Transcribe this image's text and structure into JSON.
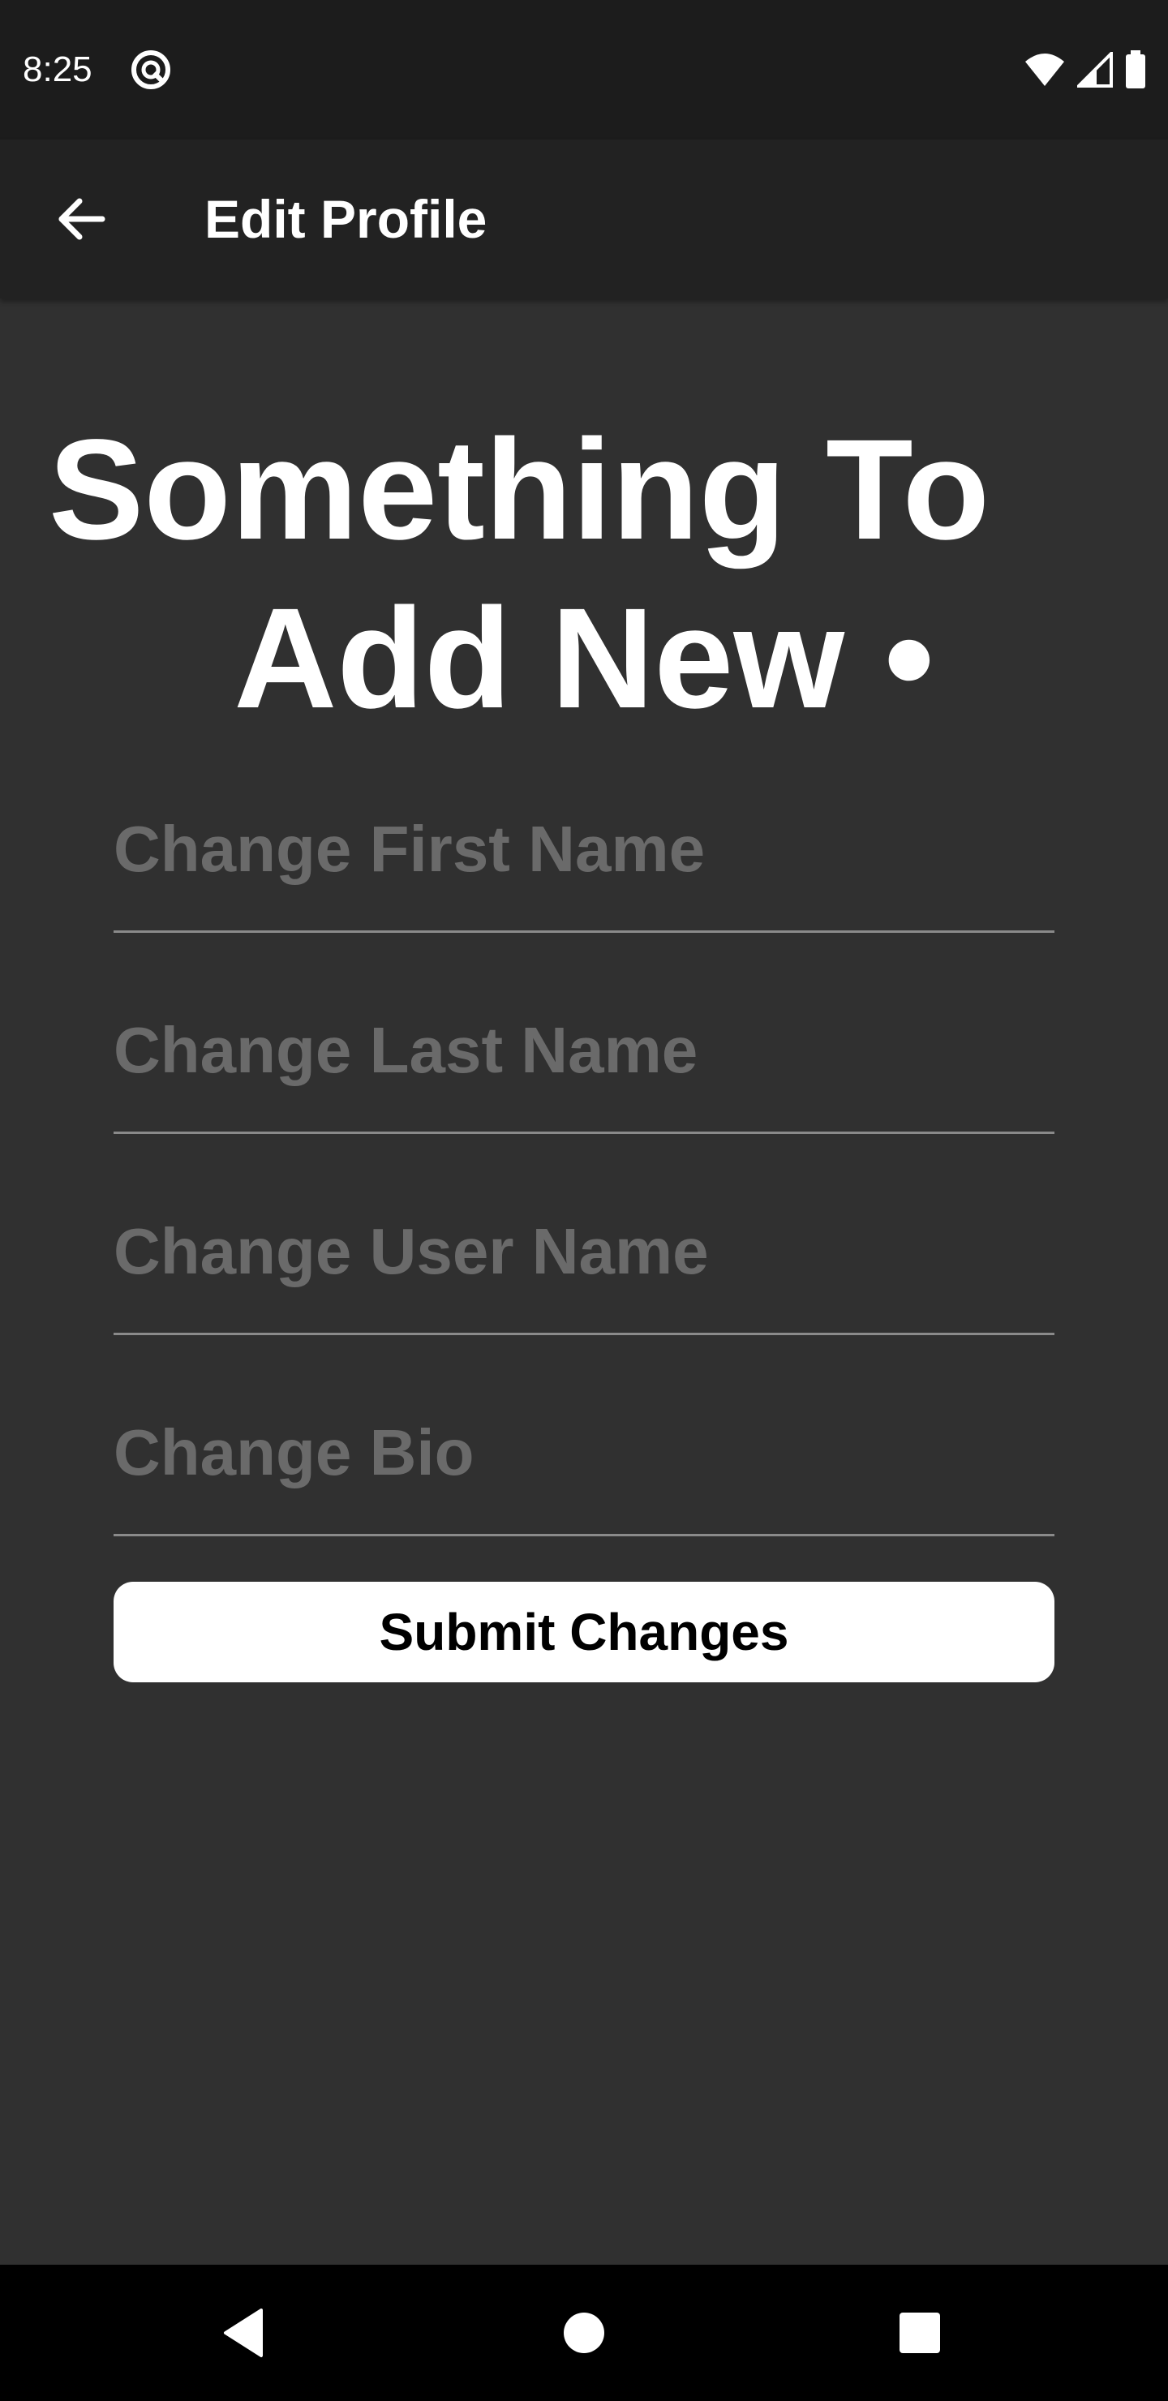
{
  "status_bar": {
    "time": "8:25",
    "app_icon": "at-sign-icon",
    "icons": [
      "wifi-icon",
      "signal-icon",
      "battery-icon"
    ]
  },
  "app_bar": {
    "back_icon": "arrow-left-icon",
    "title": "Edit Profile"
  },
  "headline": {
    "line1": "Something To",
    "line2": "Add New •"
  },
  "form": {
    "first_name": {
      "placeholder": "Change First Name",
      "value": ""
    },
    "last_name": {
      "placeholder": "Change Last Name",
      "value": ""
    },
    "user_name": {
      "placeholder": "Change User Name",
      "value": ""
    },
    "bio": {
      "placeholder": "Change Bio",
      "value": ""
    },
    "submit_label": "Submit Changes"
  },
  "nav_bar": {
    "back": "triangle-back-icon",
    "home": "circle-home-icon",
    "recents": "square-recents-icon"
  },
  "colors": {
    "background": "#303030",
    "status_bar": "#1c1c1c",
    "app_bar": "#222222",
    "placeholder": "#6a6a6a",
    "divider": "#8a8a8a",
    "button_bg": "#ffffff",
    "nav_bar": "#000000"
  }
}
